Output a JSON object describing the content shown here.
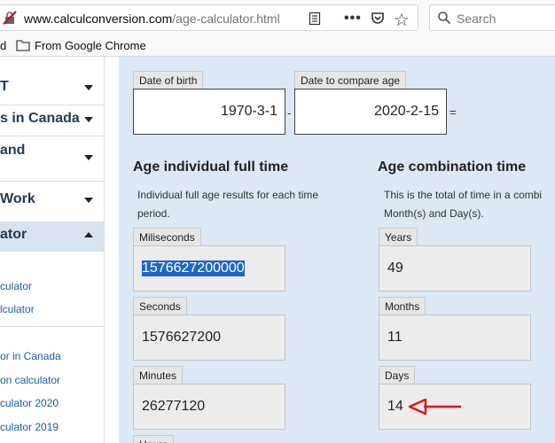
{
  "browser": {
    "url_host": "www.calculconversion.com",
    "url_path": "/age-calculator.html",
    "search_placeholder": "Search",
    "bookmark_partial": "d",
    "bookmark_folder": "From Google Chrome"
  },
  "sidebar": {
    "items": [
      {
        "label": "T",
        "caret": "down"
      },
      {
        "label": "s in Canada",
        "caret": "down"
      },
      {
        "label": "and",
        "caret": "down"
      },
      {
        "label": "Work",
        "caret": "down"
      },
      {
        "label": "ator",
        "caret": "up"
      }
    ],
    "links": [
      "culator",
      "lculator",
      "or in Canada",
      "on calculator",
      "culator 2020",
      "culator 2019"
    ]
  },
  "form": {
    "dob_label": "Date of birth",
    "dob_value": "1970-3-1",
    "dash": "-",
    "compare_label": "Date to compare age",
    "compare_value": "2020-2-15",
    "equals": "="
  },
  "full_time": {
    "title": "Age individual full time",
    "desc_line1": "Individual full age results for each time",
    "desc_line2": "period.",
    "fields": [
      {
        "label": "Miliseconds",
        "value": "1576627200000"
      },
      {
        "label": "Seconds",
        "value": "1576627200"
      },
      {
        "label": "Minutes",
        "value": "26277120"
      },
      {
        "label": "Hours",
        "value": ""
      }
    ]
  },
  "combo": {
    "title": "Age combination time",
    "desc_line1": "This is the total of time in a combi",
    "desc_line2": "Month(s) and Day(s).",
    "fields": [
      {
        "label": "Years",
        "value": "49"
      },
      {
        "label": "Months",
        "value": "11"
      },
      {
        "label": "Days",
        "value": "14"
      }
    ]
  },
  "colors": {
    "main_bg": "#dce8f3",
    "selection": "#1f66c9",
    "arrow": "#e0131a"
  }
}
